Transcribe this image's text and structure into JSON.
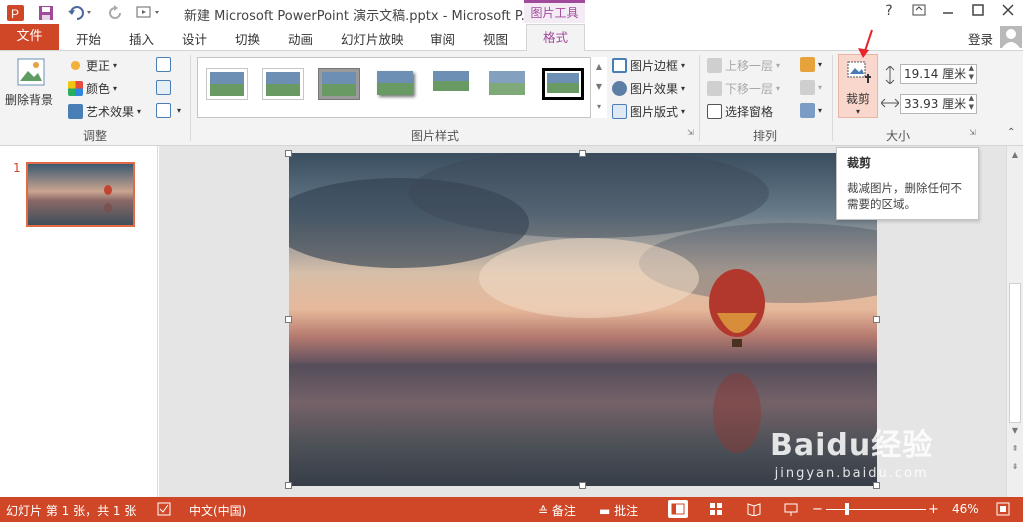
{
  "window": {
    "title": "新建 Microsoft PowerPoint 演示文稿.pptx - Microsoft P...",
    "context_tab_group": "图片工具",
    "help": "?",
    "controls": [
      "restore",
      "minimize",
      "maximize",
      "close"
    ]
  },
  "tabs": {
    "file": "文件",
    "items": [
      "开始",
      "插入",
      "设计",
      "切换",
      "动画",
      "幻灯片放映",
      "审阅",
      "视图"
    ],
    "active": "格式",
    "login": "登录"
  },
  "ribbon": {
    "adjust": {
      "label": "调整",
      "remove_background": "删除背景",
      "corrections": "更正",
      "color": "颜色",
      "artistic_effects": "艺术效果"
    },
    "styles": {
      "label": "图片样式",
      "picture_border": "图片边框",
      "picture_effects": "图片效果",
      "picture_layout": "图片版式"
    },
    "arrange": {
      "label": "排列",
      "bring_forward": "上移一层",
      "send_backward": "下移一层",
      "selection_pane": "选择窗格"
    },
    "size": {
      "label": "大小",
      "crop": "裁剪",
      "height": "19.14 厘米",
      "width": "33.93 厘米"
    }
  },
  "tooltip": {
    "title": "裁剪",
    "description": "裁减图片，删除任何不需要的区域。"
  },
  "slides_pane": {
    "slide_number": "1"
  },
  "statusbar": {
    "slide_info": "幻灯片 第 1 张，共 1 张",
    "language": "中文(中国)",
    "notes": "备注",
    "comments": "批注",
    "zoom": "46%"
  },
  "watermark": {
    "brand": "Baidu经验",
    "url": "jingyan.baidu.com"
  },
  "colors": {
    "accent": "#d04727",
    "context_purple": "#a14a9c"
  }
}
